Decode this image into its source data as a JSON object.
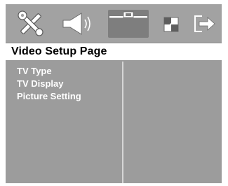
{
  "toolbar": {
    "icons": [
      {
        "name": "general-setup-icon",
        "label": "tools"
      },
      {
        "name": "audio-setup-icon",
        "label": "speaker"
      },
      {
        "name": "video-setup-icon",
        "label": "video"
      },
      {
        "name": "preference-setup-icon",
        "label": "preferences"
      },
      {
        "name": "exit-icon",
        "label": "exit"
      }
    ],
    "active_index": 2
  },
  "page": {
    "title": "Video Setup Page"
  },
  "menu": {
    "items": [
      {
        "label": "TV Type"
      },
      {
        "label": "TV Display"
      },
      {
        "label": "Picture Setting"
      }
    ]
  },
  "colors": {
    "background": "#9c9c9c",
    "toolbar": "#a2a2a2",
    "title_bar": "#ffffff",
    "text": "#ffffff",
    "divider": "#d6d6d6"
  }
}
